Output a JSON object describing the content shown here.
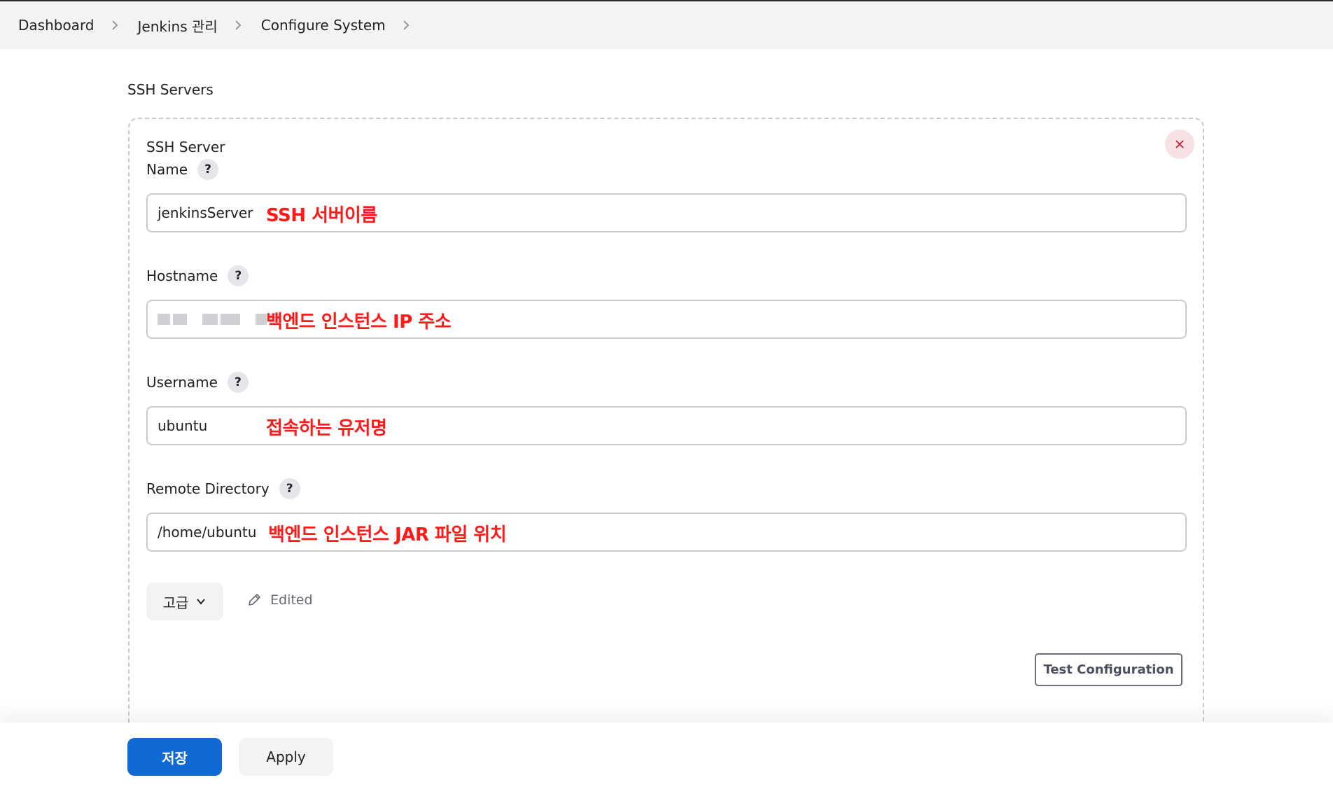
{
  "breadcrumb": {
    "items": [
      {
        "label": "Dashboard"
      },
      {
        "label": "Jenkins 관리"
      },
      {
        "label": "Configure System"
      }
    ]
  },
  "section": {
    "title": "SSH Servers"
  },
  "ssh_server": {
    "name_label_line1": "SSH Server",
    "name_label_line2": "Name",
    "name_value": "jenkinsServer",
    "name_annotation": "SSH 서버이름",
    "hostname_label": "Hostname",
    "hostname_annotation": "백엔드 인스턴스 IP 주소",
    "username_label": "Username",
    "username_value": "ubuntu",
    "username_annotation": "접속하는 유저명",
    "remote_dir_label": "Remote Directory",
    "remote_dir_value": "/home/ubuntu",
    "remote_dir_annotation": "백엔드 인스턴스 JAR 파일 위치",
    "help_glyph": "?",
    "advanced_label": "고급",
    "edited_label": "Edited",
    "test_button_label": "Test Configuration"
  },
  "footer": {
    "save_label": "저장",
    "apply_label": "Apply"
  },
  "colors": {
    "primary": "#1169d4",
    "annotation": "#ff1a1a",
    "delete_bg": "#f7e1e4",
    "delete_icon": "#d0182f"
  },
  "icons": {
    "breadcrumb_separator": "chevron-right-icon",
    "help": "question-icon",
    "delete": "close-icon",
    "advanced": "chevron-down-icon",
    "edited": "pencil-icon"
  }
}
